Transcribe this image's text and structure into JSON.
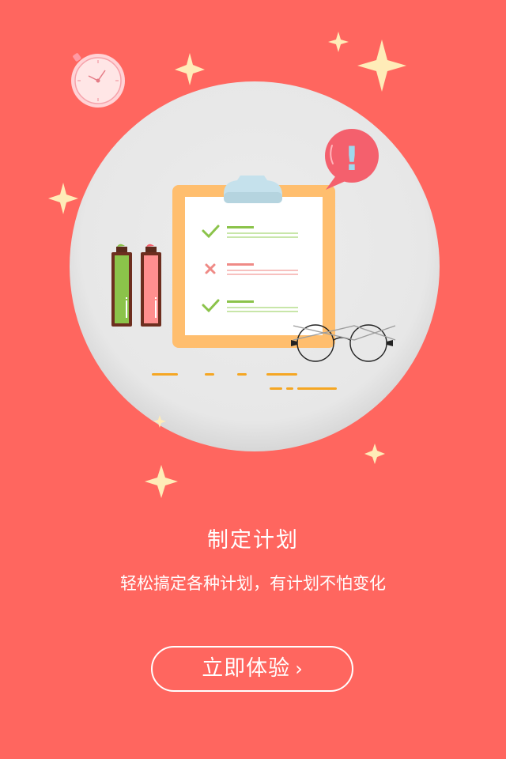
{
  "screen": {
    "title": "制定计划",
    "subtitle": "轻松搞定各种计划，有计划不怕变化",
    "cta_label": "立即体验",
    "cta_arrow": "›"
  },
  "illustration": {
    "icons": [
      "stopwatch-icon",
      "sparkle-icon",
      "clipboard-icon",
      "check-icon",
      "cross-icon",
      "exclamation-bubble-icon",
      "battery-icon",
      "glasses-icon"
    ],
    "bubble_text": "!"
  },
  "colors": {
    "background": "#ff665f",
    "circle": "#e9e9e9",
    "clipboard_frame": "#ffbe6e",
    "accent_green": "#8bc34a",
    "accent_red": "#ef8a86",
    "sparkle": "#ffecb8"
  }
}
